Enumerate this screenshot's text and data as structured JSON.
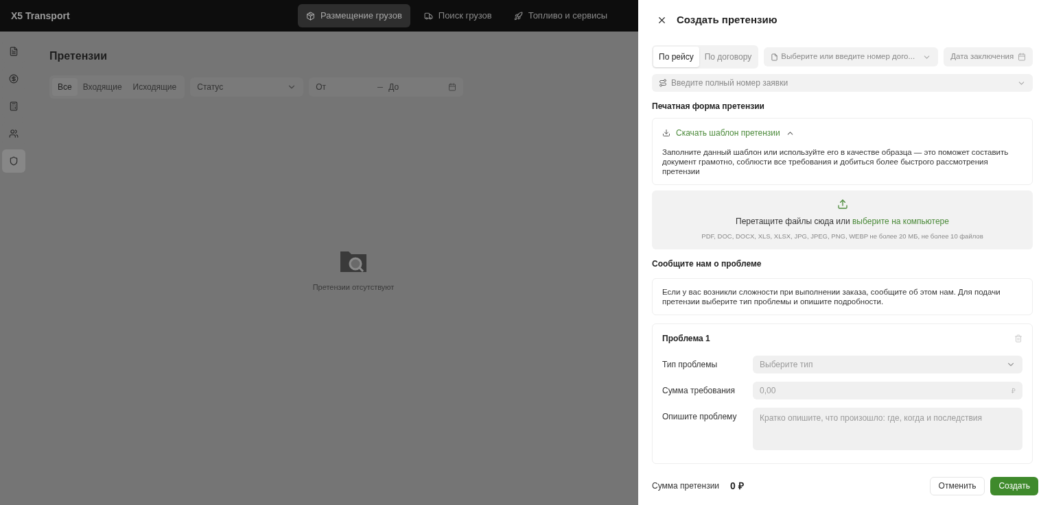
{
  "header": {
    "logo": "X5 Transport",
    "nav": [
      {
        "label": "Размещение грузов",
        "kind": "box",
        "selected": true
      },
      {
        "label": "Поиск грузов",
        "kind": "truck",
        "selected": false
      },
      {
        "label": "Топливо и сервисы",
        "kind": "rocket",
        "selected": false
      }
    ]
  },
  "sidebar": {
    "items": [
      {
        "kind": "document",
        "selected": false
      },
      {
        "kind": "ruble",
        "selected": false
      },
      {
        "kind": "calculator",
        "selected": false
      },
      {
        "kind": "users",
        "selected": false
      },
      {
        "kind": "shield",
        "selected": true
      }
    ]
  },
  "page": {
    "title": "Претензии",
    "filter_tabs": [
      {
        "label": "Все",
        "selected": true
      },
      {
        "label": "Входящие",
        "selected": false
      },
      {
        "label": "Исходящие",
        "selected": false
      }
    ],
    "status": {
      "placeholder": "Статус"
    },
    "date_from": {
      "placeholder": "От"
    },
    "date_to": {
      "placeholder": "До"
    },
    "empty_text": "Претензии отсутствуют"
  },
  "drawer": {
    "title": "Создать претензию",
    "mode_tabs": [
      {
        "label": "По рейсу",
        "selected": true
      },
      {
        "label": "По договору",
        "selected": false
      }
    ],
    "contract": {
      "placeholder": "Выберите или введите номер дого..."
    },
    "contract_date": {
      "placeholder": "Дата заключения"
    },
    "order": {
      "placeholder": "Введите полный номер заявки"
    },
    "print_form": {
      "heading": "Печатная форма претензии",
      "download_label": "Скачать шаблон претензии",
      "expanded": true,
      "description": "Заполните данный шаблон или используйте его в качестве образца — это поможет составить документ грамотно, соблюсти все требования и добиться более быстрого рассмотрения претензии"
    },
    "upload": {
      "text": "Перетащите файлы сюда или",
      "link": "выберите на компьютере",
      "hint": "PDF, DOC, DOCX, XLS, XLSX, JPG, JPEG, PNG, WEBP не более 20 МБ, не более 10 файлов"
    },
    "problem_section": {
      "heading": "Сообщите нам о проблеме",
      "info": "Если у вас возникли сложности при выполнении заказа, сообщите об этом нам. Для подачи претензии выберите тип проблемы и опишите подробности."
    },
    "problems": [
      {
        "title": "Проблема 1",
        "fields": [
          {
            "kind": "select",
            "label": "Тип проблемы",
            "placeholder": "Выберите тип"
          },
          {
            "kind": "money",
            "label": "Сумма требования",
            "placeholder": "0,00",
            "currency": "₽"
          },
          {
            "kind": "textarea",
            "label": "Опишите проблему",
            "placeholder": "Кратко опишите, что произошло: где, когда и последствия"
          }
        ]
      }
    ],
    "footer": {
      "total_label": "Сумма претензии",
      "total_value": "0 ₽",
      "buttons": [
        {
          "kind": "secondary",
          "label": "Отменить"
        },
        {
          "kind": "primary",
          "label": "Создать"
        }
      ]
    }
  }
}
